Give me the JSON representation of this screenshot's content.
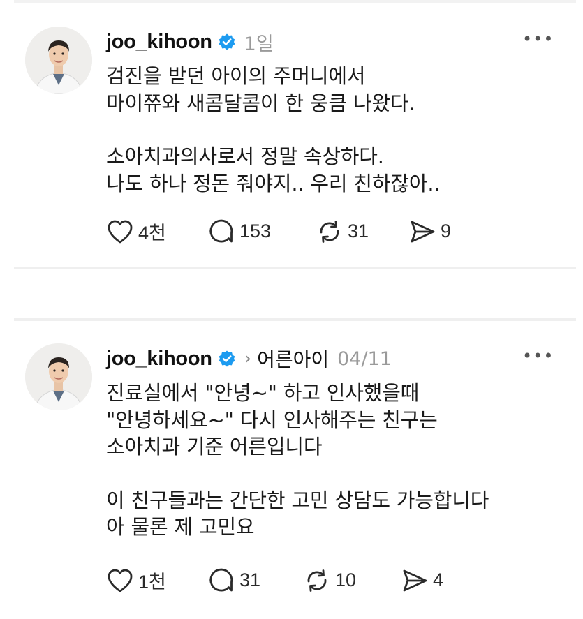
{
  "posts": [
    {
      "username": "joo_kihoon",
      "time": "1일",
      "community": null,
      "paragraphs": [
        [
          "검진을 받던 아이의 주머니에서",
          "마이쮸와 새콤달콤이 한 웅큼 나왔다."
        ],
        [
          "소아치과의사로서 정말 속상하다.",
          "나도 하나 정돈 줘야지.. 우리 친하잖아.."
        ]
      ],
      "likes": "4천",
      "comments": "153",
      "reposts": "31",
      "shares": "9"
    },
    {
      "username": "joo_kihoon",
      "time": "04/11",
      "community": "어른아이",
      "paragraphs": [
        [
          "진료실에서 \"안녕~\" 하고 인사했을때",
          "\"안녕하세요~\" 다시 인사해주는 친구는",
          "소아치과 기준 어른입니다"
        ],
        [
          "이 친구들과는 간단한 고민 상담도 가능합니다",
          "아 물론 제 고민요"
        ]
      ],
      "likes": "1천",
      "comments": "31",
      "reposts": "10",
      "shares": "4"
    }
  ],
  "icons": {
    "verified": "verified-badge-icon",
    "more": "more-horizontal-icon",
    "like": "heart-icon",
    "comment": "comment-bubble-icon",
    "repost": "repost-arrows-icon",
    "share": "send-paper-plane-icon",
    "chevron": "chevron-right-icon"
  },
  "colors": {
    "verified": "#1d9bf0",
    "muted": "#9a9a9a",
    "text": "#1a1a1a"
  }
}
